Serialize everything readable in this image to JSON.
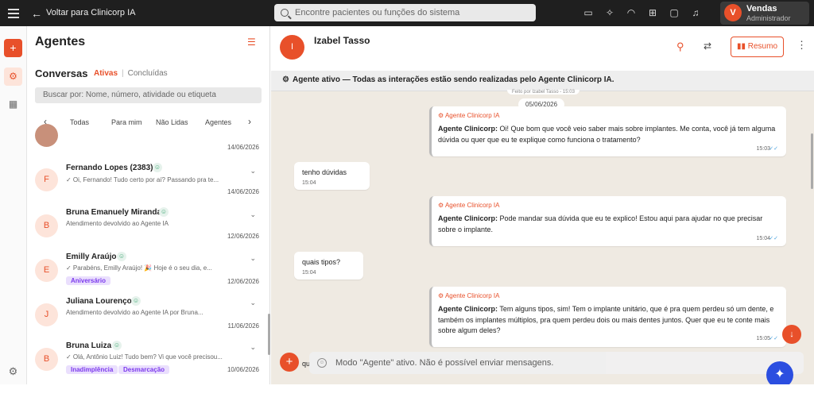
{
  "topbar": {
    "back_label": "Voltar para Clinicorp IA",
    "search_placeholder": "Encontre pacientes ou funções do sistema",
    "icons": [
      "video-icon",
      "sparkle-icon",
      "headset-icon",
      "chat-plus-icon",
      "message-icon",
      "bell-icon"
    ],
    "user": {
      "initial": "V",
      "name": "Vendas",
      "role": "Administrador"
    }
  },
  "colors": {
    "accent": "#e8502a",
    "topbar": "#1f1f1f",
    "chat_bg": "#efeae2",
    "tag": "#7c3aed",
    "fab": "#2b4ee0"
  },
  "list": {
    "title": "Agentes",
    "conversations_label": "Conversas",
    "tab_active": "Ativas",
    "tab_done": "Concluídas",
    "search_placeholder": "Buscar por: Nome, número, atividade ou etiqueta",
    "filters": [
      "Todas",
      "Para mim",
      "Não Lidas",
      "Agentes"
    ],
    "first_date": "14/06/2026",
    "items": [
      {
        "initial": "F",
        "name": "Fernando Lopes (2383)",
        "message": "✓ Oi, Fernando! Tudo certo por aí? Passando pra te...",
        "date": "14/06/2026",
        "tags": []
      },
      {
        "initial": "B",
        "name": "Bruna Emanuely Miranda",
        "message": "Atendimento devolvido ao Agente IA",
        "date": "12/06/2026",
        "tags": []
      },
      {
        "initial": "E",
        "name": "Emilly Araújo",
        "message": "✓ Parabéns, Emilly Araújo! 🎉 Hoje é o seu dia, e...",
        "date": "12/06/2026",
        "tags": [
          "Aniversário"
        ]
      },
      {
        "initial": "J",
        "name": "Juliana Lourenço",
        "message": "Atendimento devolvido ao Agente IA por Bruna...",
        "date": "11/06/2026",
        "tags": []
      },
      {
        "initial": "B",
        "name": "Bruna Luiza",
        "message": "✓ Olá, Antônio Luiz! Tudo bem? Vi que você precisou...",
        "date": "10/06/2026",
        "tags": [
          "Inadimplência",
          "Desmarcação"
        ]
      }
    ]
  },
  "chat": {
    "contact_initial": "I",
    "contact_name": "Izabel Tasso",
    "summary_label": "Resumo",
    "banner": "Agente ativo — Todas as interações estão sendo realizadas pelo Agente Clinicorp IA.",
    "done_by": "Feito por Izabel Tasso - 15:03",
    "date_chip": "05/06/2026",
    "agent_label": "Agente Clinicorp IA",
    "messages": [
      {
        "from": "agent",
        "prefix": "Agente Clinicorp:",
        "text": "Oi! Que bom que você veio saber mais sobre implantes. Me conta, você já tem alguma dúvida ou quer que eu te explique como funciona o tratamento?",
        "time": "15:03"
      },
      {
        "from": "user",
        "text": "tenho dúvidas",
        "time": "15:04"
      },
      {
        "from": "agent",
        "prefix": "Agente Clinicorp:",
        "text": "Pode mandar sua dúvida que eu te explico! Estou aqui para ajudar no que precisar sobre o implante.",
        "time": "15:04"
      },
      {
        "from": "user",
        "text": "quais tipos?",
        "time": "15:04"
      },
      {
        "from": "agent",
        "prefix": "Agente Clinicorp:",
        "text": "Tem alguns tipos, sim! Tem o implante unitário, que é pra quem perdeu só um dente, e também os implantes múltiplos, pra quem perdeu dois ou mais dentes juntos. Quer que eu te conte mais sobre algum deles?",
        "time": "15:05"
      }
    ],
    "partial_text": "qu",
    "input_placeholder": "Modo \"Agente\" ativo. Não é possível enviar mensagens."
  }
}
